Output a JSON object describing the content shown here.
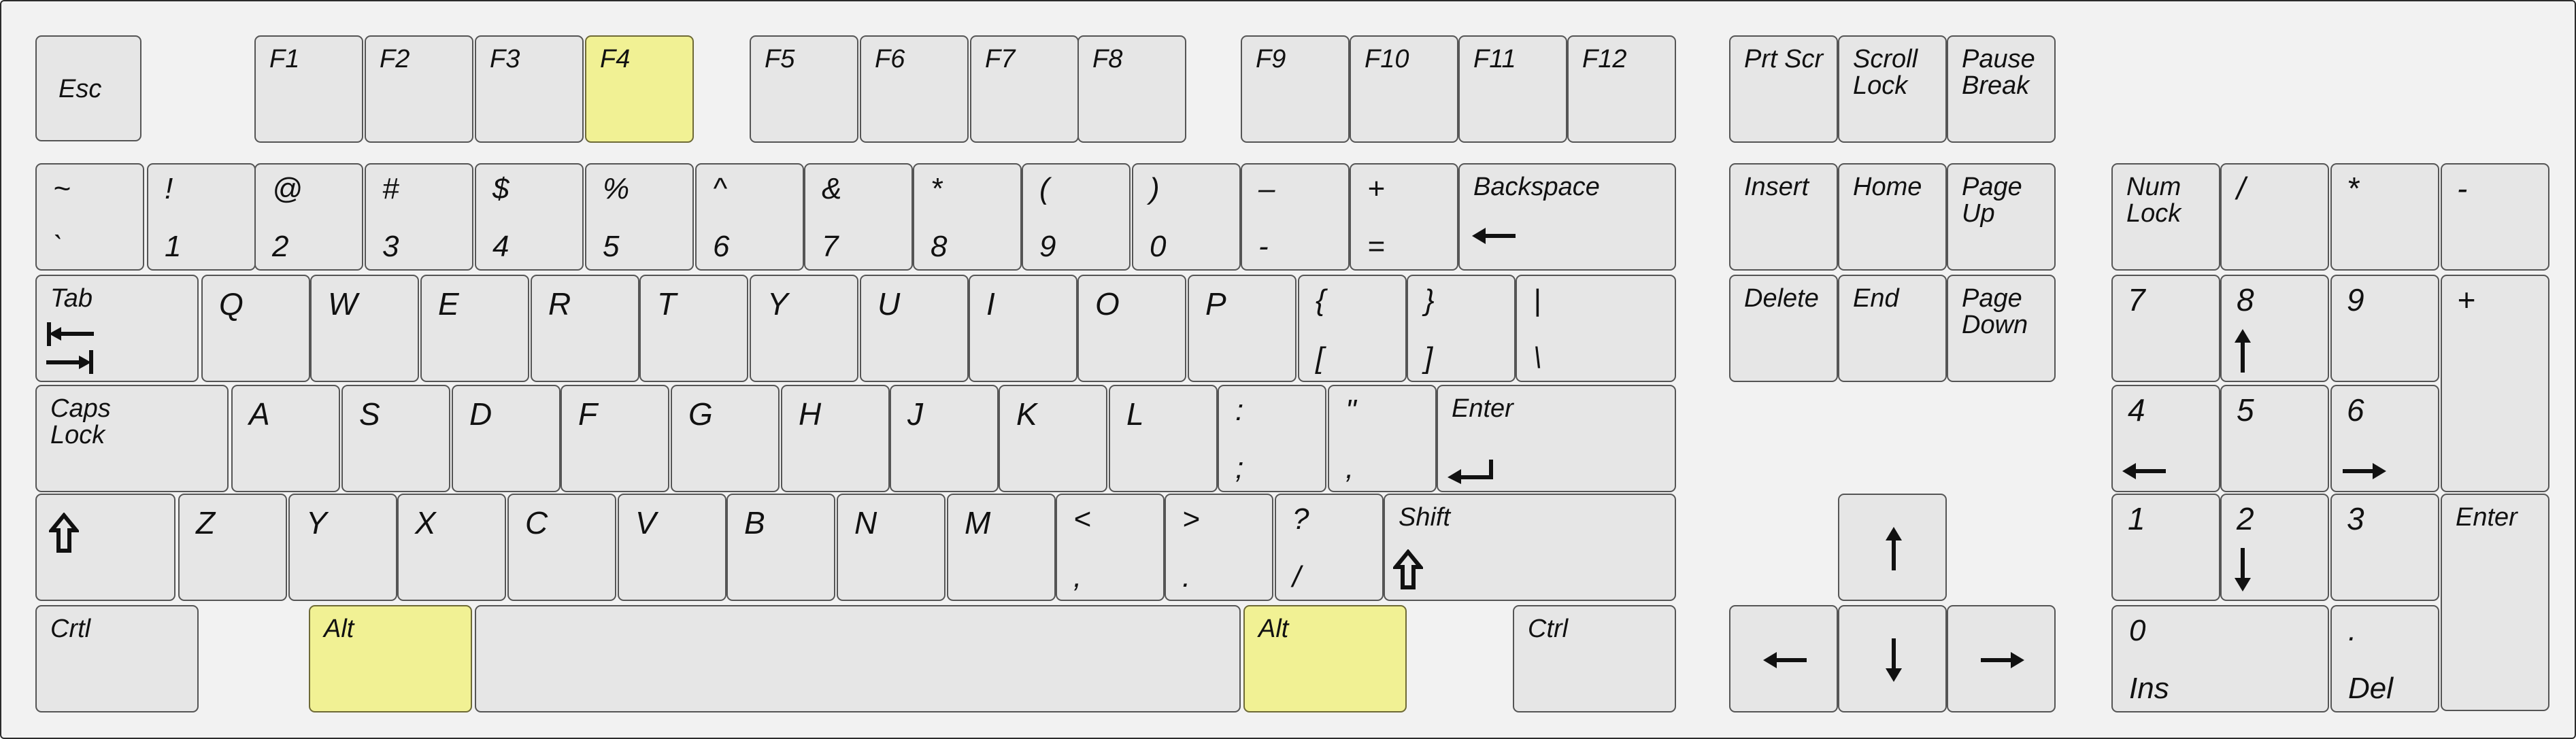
{
  "colors": {
    "board": "#f2f2f2",
    "key": "#e6e6e6",
    "key_border": "#555555",
    "highlight": "#f1f194"
  },
  "highlighted_keys": [
    "F4",
    "Alt (left)",
    "Alt (right)"
  ],
  "keys": [
    {
      "id": "esc",
      "labels": [
        "Esc"
      ]
    },
    {
      "id": "f1",
      "labels": [
        "F1"
      ]
    },
    {
      "id": "f2",
      "labels": [
        "F2"
      ]
    },
    {
      "id": "f3",
      "labels": [
        "F3"
      ]
    },
    {
      "id": "f4",
      "labels": [
        "F4"
      ],
      "highlight": true
    },
    {
      "id": "f5",
      "labels": [
        "F5"
      ]
    },
    {
      "id": "f6",
      "labels": [
        "F6"
      ]
    },
    {
      "id": "f7",
      "labels": [
        "F7"
      ]
    },
    {
      "id": "f8",
      "labels": [
        "F8"
      ]
    },
    {
      "id": "f9",
      "labels": [
        "F9"
      ]
    },
    {
      "id": "f10",
      "labels": [
        "F10"
      ]
    },
    {
      "id": "f11",
      "labels": [
        "F11"
      ]
    },
    {
      "id": "f12",
      "labels": [
        "F12"
      ]
    },
    {
      "id": "prtscr",
      "labels": [
        "Prt Scr"
      ]
    },
    {
      "id": "scrolllock",
      "labels": [
        "Scroll\nLock"
      ]
    },
    {
      "id": "pausebreak",
      "labels": [
        "Pause\nBreak"
      ]
    },
    {
      "id": "tilde",
      "labels": [
        "~",
        "`"
      ]
    },
    {
      "id": "d1",
      "labels": [
        "!",
        "1"
      ]
    },
    {
      "id": "d2",
      "labels": [
        "@",
        "2"
      ]
    },
    {
      "id": "d3",
      "labels": [
        "#",
        "3"
      ]
    },
    {
      "id": "d4",
      "labels": [
        "$",
        "4"
      ]
    },
    {
      "id": "d5",
      "labels": [
        "%",
        "5"
      ]
    },
    {
      "id": "d6",
      "labels": [
        "^",
        "6"
      ]
    },
    {
      "id": "d7",
      "labels": [
        "&",
        "7"
      ]
    },
    {
      "id": "d8",
      "labels": [
        "*",
        "8"
      ]
    },
    {
      "id": "d9",
      "labels": [
        "(",
        "9"
      ]
    },
    {
      "id": "d0",
      "labels": [
        ")",
        "0"
      ]
    },
    {
      "id": "minus",
      "labels": [
        "–",
        "-"
      ]
    },
    {
      "id": "equals",
      "labels": [
        "+",
        "="
      ]
    },
    {
      "id": "backspace",
      "labels": [
        "Backspace"
      ],
      "icon": "arrow-left-icon"
    },
    {
      "id": "insert",
      "labels": [
        "Insert"
      ]
    },
    {
      "id": "home",
      "labels": [
        "Home"
      ]
    },
    {
      "id": "pageup",
      "labels": [
        "Page\nUp"
      ]
    },
    {
      "id": "numlock",
      "labels": [
        "Num\nLock"
      ]
    },
    {
      "id": "npslash",
      "labels": [
        "/"
      ]
    },
    {
      "id": "npstar",
      "labels": [
        "*"
      ]
    },
    {
      "id": "npminus",
      "labels": [
        "-"
      ]
    },
    {
      "id": "tab",
      "labels": [
        "Tab"
      ],
      "icon": "tab-arrows-icon"
    },
    {
      "id": "q",
      "labels": [
        "Q"
      ]
    },
    {
      "id": "w",
      "labels": [
        "W"
      ]
    },
    {
      "id": "e",
      "labels": [
        "E"
      ]
    },
    {
      "id": "r",
      "labels": [
        "R"
      ]
    },
    {
      "id": "t",
      "labels": [
        "T"
      ]
    },
    {
      "id": "y",
      "labels": [
        "Y"
      ]
    },
    {
      "id": "u",
      "labels": [
        "U"
      ]
    },
    {
      "id": "i",
      "labels": [
        "I"
      ]
    },
    {
      "id": "o",
      "labels": [
        "O"
      ]
    },
    {
      "id": "p",
      "labels": [
        "P"
      ]
    },
    {
      "id": "lbrace",
      "labels": [
        "{",
        "["
      ]
    },
    {
      "id": "rbrace",
      "labels": [
        "}",
        "]"
      ]
    },
    {
      "id": "pipe",
      "labels": [
        "|",
        "\\"
      ]
    },
    {
      "id": "delete",
      "labels": [
        "Delete"
      ]
    },
    {
      "id": "end",
      "labels": [
        "End"
      ]
    },
    {
      "id": "pagedown",
      "labels": [
        "Page\nDown"
      ]
    },
    {
      "id": "np7",
      "labels": [
        "7"
      ]
    },
    {
      "id": "np8",
      "labels": [
        "8"
      ],
      "icon": "arrow-up-icon"
    },
    {
      "id": "np9",
      "labels": [
        "9"
      ]
    },
    {
      "id": "npplus",
      "labels": [
        "+"
      ]
    },
    {
      "id": "capslock",
      "labels": [
        "Caps\nLock"
      ]
    },
    {
      "id": "a",
      "labels": [
        "A"
      ]
    },
    {
      "id": "s",
      "labels": [
        "S"
      ]
    },
    {
      "id": "d",
      "labels": [
        "D"
      ]
    },
    {
      "id": "f",
      "labels": [
        "F"
      ]
    },
    {
      "id": "g",
      "labels": [
        "G"
      ]
    },
    {
      "id": "h",
      "labels": [
        "H"
      ]
    },
    {
      "id": "j",
      "labels": [
        "J"
      ]
    },
    {
      "id": "k",
      "labels": [
        "K"
      ]
    },
    {
      "id": "l",
      "labels": [
        "L"
      ]
    },
    {
      "id": "colon",
      "labels": [
        ":",
        ";"
      ]
    },
    {
      "id": "quote",
      "labels": [
        "\"",
        ","
      ]
    },
    {
      "id": "enter",
      "labels": [
        "Enter"
      ],
      "icon": "enter-arrow-icon"
    },
    {
      "id": "np4",
      "labels": [
        "4"
      ],
      "icon": "arrow-left-icon"
    },
    {
      "id": "np5",
      "labels": [
        "5"
      ]
    },
    {
      "id": "np6",
      "labels": [
        "6"
      ],
      "icon": "arrow-right-icon"
    },
    {
      "id": "lshift",
      "labels": [
        ""
      ],
      "icon": "shift-arrow-icon"
    },
    {
      "id": "z",
      "labels": [
        "Z"
      ]
    },
    {
      "id": "x",
      "labels": [
        "Y"
      ]
    },
    {
      "id": "c",
      "labels": [
        "X"
      ]
    },
    {
      "id": "v",
      "labels": [
        "C"
      ]
    },
    {
      "id": "b",
      "labels": [
        "V"
      ]
    },
    {
      "id": "n",
      "labels": [
        "B"
      ]
    },
    {
      "id": "m",
      "labels": [
        "N"
      ]
    },
    {
      "id": "m2",
      "labels": [
        "M"
      ]
    },
    {
      "id": "comma",
      "labels": [
        "<",
        ","
      ]
    },
    {
      "id": "period",
      "labels": [
        ">",
        "."
      ]
    },
    {
      "id": "slash",
      "labels": [
        "?",
        "/"
      ]
    },
    {
      "id": "rshift",
      "labels": [
        "Shift"
      ],
      "icon": "shift-arrow-icon"
    },
    {
      "id": "arrowup",
      "labels": [
        ""
      ],
      "icon": "arrow-up-icon"
    },
    {
      "id": "np1",
      "labels": [
        "1"
      ]
    },
    {
      "id": "np2",
      "labels": [
        "2"
      ],
      "icon": "arrow-down-icon"
    },
    {
      "id": "np3",
      "labels": [
        "3"
      ]
    },
    {
      "id": "npenter",
      "labels": [
        "Enter"
      ]
    },
    {
      "id": "lctrl",
      "labels": [
        "Crtl"
      ]
    },
    {
      "id": "lalt",
      "labels": [
        "Alt"
      ],
      "highlight": true
    },
    {
      "id": "space",
      "labels": [
        ""
      ]
    },
    {
      "id": "ralt",
      "labels": [
        "Alt"
      ],
      "highlight": true
    },
    {
      "id": "rctrl",
      "labels": [
        "Ctrl"
      ]
    },
    {
      "id": "arrowleft",
      "labels": [
        ""
      ],
      "icon": "arrow-left-icon"
    },
    {
      "id": "arrowdown",
      "labels": [
        ""
      ],
      "icon": "arrow-down-icon"
    },
    {
      "id": "arrowright",
      "labels": [
        ""
      ],
      "icon": "arrow-right-icon"
    },
    {
      "id": "np0",
      "labels": [
        "0",
        "Ins"
      ]
    },
    {
      "id": "npdot",
      "labels": [
        ".",
        "Del"
      ]
    }
  ]
}
